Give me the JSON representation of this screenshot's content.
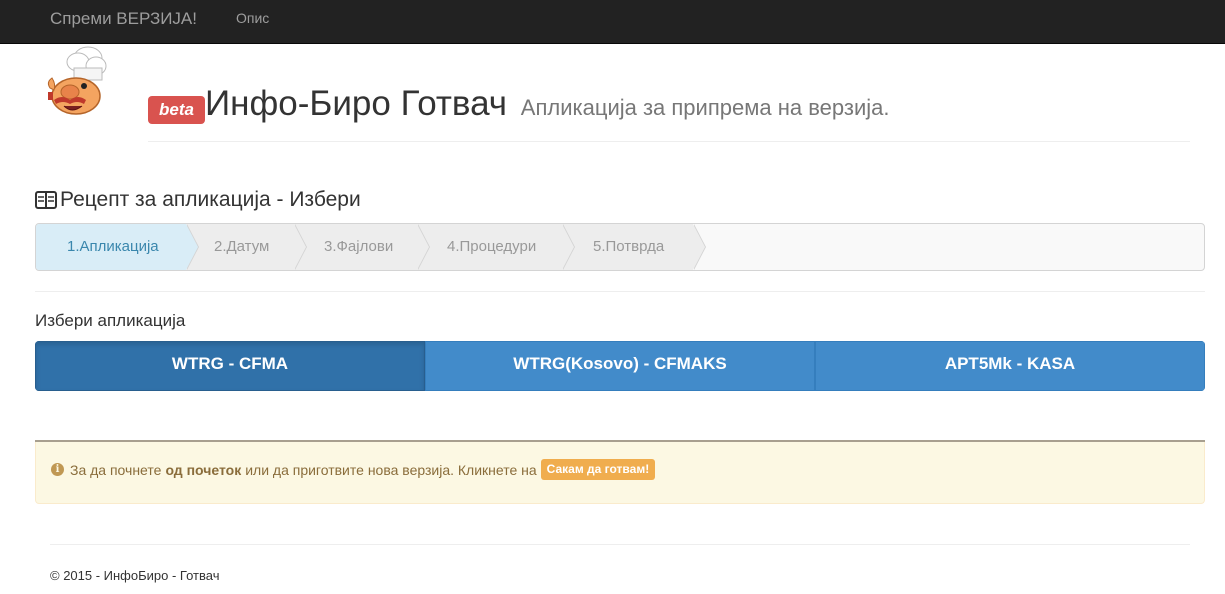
{
  "navbar": {
    "brand": "Спреми ВЕРЗИЈА!",
    "link": "Опис"
  },
  "header": {
    "badge": "beta",
    "title": "Инфо-Биро Готвач",
    "subtitle": "Апликација за припрема на верзија.",
    "logo_icon": "chef-mascot-icon"
  },
  "section": {
    "icon": "book-icon",
    "heading": "Рецепт за апликација - Избери"
  },
  "wizard": {
    "steps": [
      {
        "label": "1.Апликација",
        "active": true
      },
      {
        "label": "2.Датум",
        "active": false
      },
      {
        "label": "3.Фајлови",
        "active": false
      },
      {
        "label": "4.Процедури",
        "active": false
      },
      {
        "label": "5.Потврда",
        "active": false
      }
    ]
  },
  "apps": {
    "label": "Избери апликација",
    "buttons": [
      {
        "label": "WTRG - CFMA",
        "active": true
      },
      {
        "label": "WTRG(Kosovo) - CFMAKS",
        "active": false
      },
      {
        "label": "APT5Mk - KASA",
        "active": false
      }
    ]
  },
  "alert": {
    "icon": "info-icon",
    "text_before": "За да почнете",
    "bold": "од почеток",
    "text_after": "или да приготвите нова верзија. Кликнете на",
    "button": "Сакам да готвам!"
  },
  "footer": {
    "text": "© 2015 - ИнфоБиро - Готвач"
  },
  "colors": {
    "navbar": "#222222",
    "primary": "#428bca",
    "danger": "#d9534f",
    "warning": "#f0ad4e",
    "active_step": "#d9edf7"
  }
}
